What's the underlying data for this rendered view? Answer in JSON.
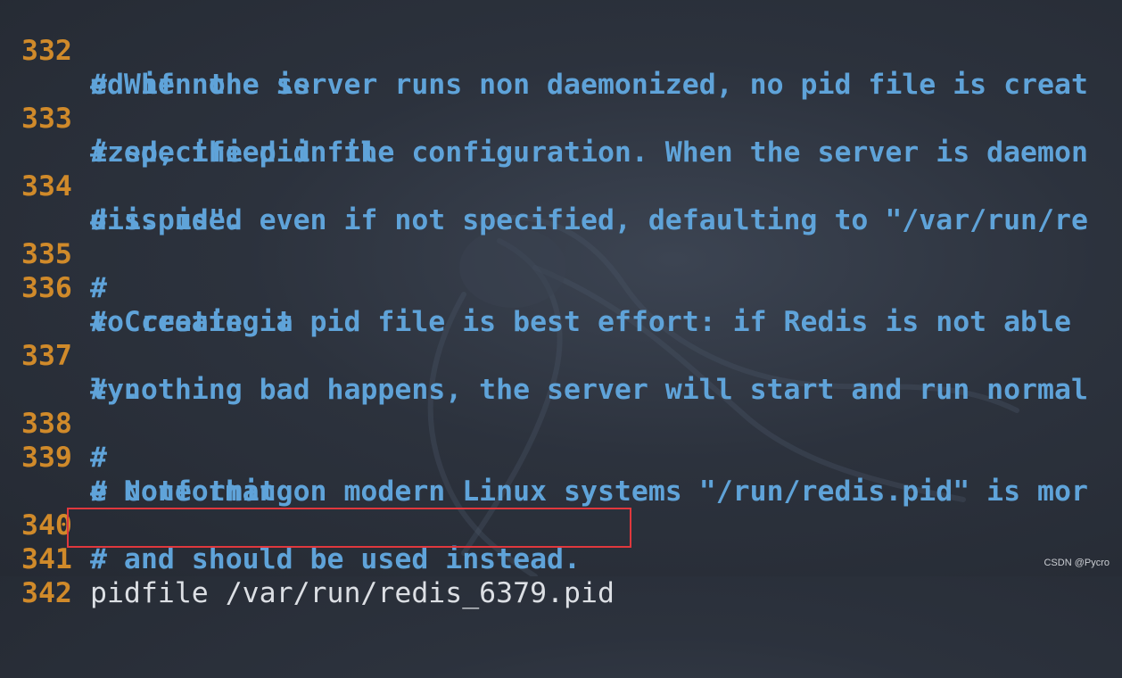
{
  "editor": {
    "lines": [
      {
        "num": "332",
        "text": "# When the server runs non daemonized, no pid file is creat",
        "cont": "ed if none is"
      },
      {
        "num": "333",
        "text": "# specified in the configuration. When the server is daemon",
        "cont": "ized, the pid file"
      },
      {
        "num": "334",
        "text": "# is used even if not specified, defaulting to \"/var/run/re",
        "cont": "dis.pid\"."
      },
      {
        "num": "335",
        "text": "#",
        "cont": ""
      },
      {
        "num": "336",
        "text": "# Creating a pid file is best effort: if Redis is not able",
        "cont": "to create it"
      },
      {
        "num": "337",
        "text": "# nothing bad happens, the server will start and run normal",
        "cont": "ly."
      },
      {
        "num": "338",
        "text": "#",
        "cont": ""
      },
      {
        "num": "339",
        "text": "# Note that on modern Linux systems \"/run/redis.pid\" is mor",
        "cont": "e conforming"
      },
      {
        "num": "340",
        "text": "# and should be used instead.",
        "cont": ""
      },
      {
        "num": "341",
        "text": "pidfile /var/run/redis_6379.pid",
        "cont": ""
      },
      {
        "num": "342",
        "text": "",
        "cont": ""
      }
    ]
  },
  "watermark": "CSDN @Pycro",
  "colors": {
    "line_number": "#d08a2a",
    "comment": "#5fa3d9",
    "code": "#dcdfe4",
    "highlight_border": "#e0383d",
    "background": "#2c323d"
  }
}
